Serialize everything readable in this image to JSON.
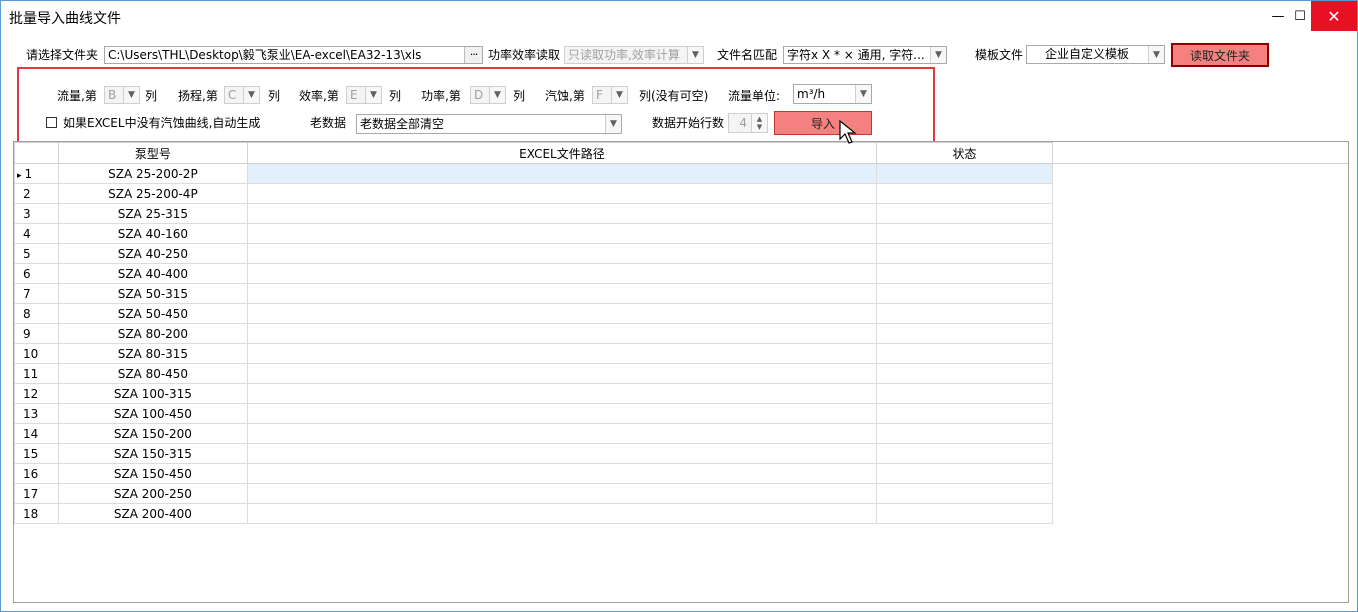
{
  "window": {
    "title": "批量导入曲线文件",
    "minimize": "—",
    "maximize": "☐",
    "close": "✕"
  },
  "top": {
    "folder_label": "请选择文件夹",
    "folder_value": "C:\\Users\\THL\\Desktop\\毅飞泵业\\EA-excel\\EA32-13\\xls",
    "browse": "···",
    "power_label": "功率效率读取",
    "power_value": "只读取功率,效率计算",
    "filename_label": "文件名匹配",
    "filename_value": "字符x X * × 通用, 字符...",
    "template_label": "模板文件",
    "template_value": "企业自定义模板",
    "read_folder_button": "读取文件夹"
  },
  "options": {
    "flow_label": "流量,第",
    "flow_col": "B",
    "head_label": "扬程,第",
    "head_col": "C",
    "eff_label": "效率,第",
    "eff_col": "E",
    "power_label": "功率,第",
    "power_col": "D",
    "npsh_label": "汽蚀,第",
    "npsh_col": "F",
    "col_suffix": "列",
    "npsh_suffix": "列(没有可空)",
    "flow_unit_label": "流量单位:",
    "flow_unit_value": "m³/h",
    "auto_npsh_label": "如果EXCEL中没有汽蚀曲线,自动生成",
    "old_data_label": "老数据",
    "old_data_value": "老数据全部清空",
    "start_row_label": "数据开始行数",
    "start_row_value": "4",
    "import_button": "导入"
  },
  "grid": {
    "headers": [
      "泵型号",
      "EXCEL文件路径",
      "状态"
    ],
    "rows": [
      {
        "n": "1",
        "model": "SZA 25-200-2P"
      },
      {
        "n": "2",
        "model": "SZA 25-200-4P"
      },
      {
        "n": "3",
        "model": "SZA 25-315"
      },
      {
        "n": "4",
        "model": "SZA 40-160"
      },
      {
        "n": "5",
        "model": "SZA 40-250"
      },
      {
        "n": "6",
        "model": "SZA 40-400"
      },
      {
        "n": "7",
        "model": "SZA 50-315"
      },
      {
        "n": "8",
        "model": "SZA 50-450"
      },
      {
        "n": "9",
        "model": "SZA 80-200"
      },
      {
        "n": "10",
        "model": "SZA 80-315"
      },
      {
        "n": "11",
        "model": "SZA 80-450"
      },
      {
        "n": "12",
        "model": "SZA 100-315"
      },
      {
        "n": "13",
        "model": "SZA 100-450"
      },
      {
        "n": "14",
        "model": "SZA 150-200"
      },
      {
        "n": "15",
        "model": "SZA 150-315"
      },
      {
        "n": "16",
        "model": "SZA 150-450"
      },
      {
        "n": "17",
        "model": "SZA 200-250"
      },
      {
        "n": "18",
        "model": "SZA 200-400"
      }
    ]
  },
  "colors": {
    "accent_border": "#5b9bd5",
    "button_red": "#f58080",
    "highlight_red": "#e03a3a",
    "selected_row": "#e3effa"
  }
}
